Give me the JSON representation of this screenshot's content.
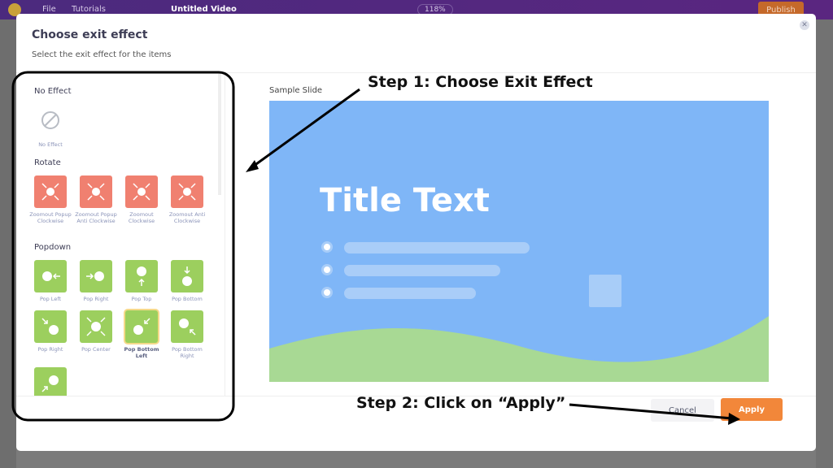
{
  "topbar": {
    "file": "File",
    "tutorials": "Tutorials",
    "doc_title": "Untitled Video",
    "zoom": "118%",
    "publish": "Publish"
  },
  "modal": {
    "title": "Choose exit effect",
    "subtitle": "Select the exit effect for the items",
    "close_icon": "close-icon",
    "sections": {
      "none": {
        "title": "No Effect",
        "items": [
          "No Effect"
        ]
      },
      "rotate": {
        "title": "Rotate",
        "items": [
          "Zoomout Popup Clockwise",
          "Zoomout Popup Anti Clockwise",
          "Zoomout Clockwise",
          "Zoomout Anti Clockwise"
        ]
      },
      "popdown": {
        "title": "Popdown",
        "items": [
          "Pop Left",
          "Pop Right",
          "Pop Top",
          "Pop Bottom",
          "Pop Right",
          "Pop Center",
          "Pop Bottom Left",
          "Pop Bottom Right"
        ],
        "selected": "Pop Bottom Left"
      }
    },
    "sample_label": "Sample Slide",
    "slide_title": "Title Text",
    "cancel": "Cancel",
    "apply": "Apply"
  },
  "annotations": {
    "step1": "Step 1: Choose Exit Effect",
    "step2": "Step 2: Click on “Apply”"
  },
  "colors": {
    "rotate": "#f08070",
    "popdown": "#9ccf5e",
    "apply": "#f2873a",
    "slide": "#7fb6f7",
    "wave": "#a8d994"
  }
}
